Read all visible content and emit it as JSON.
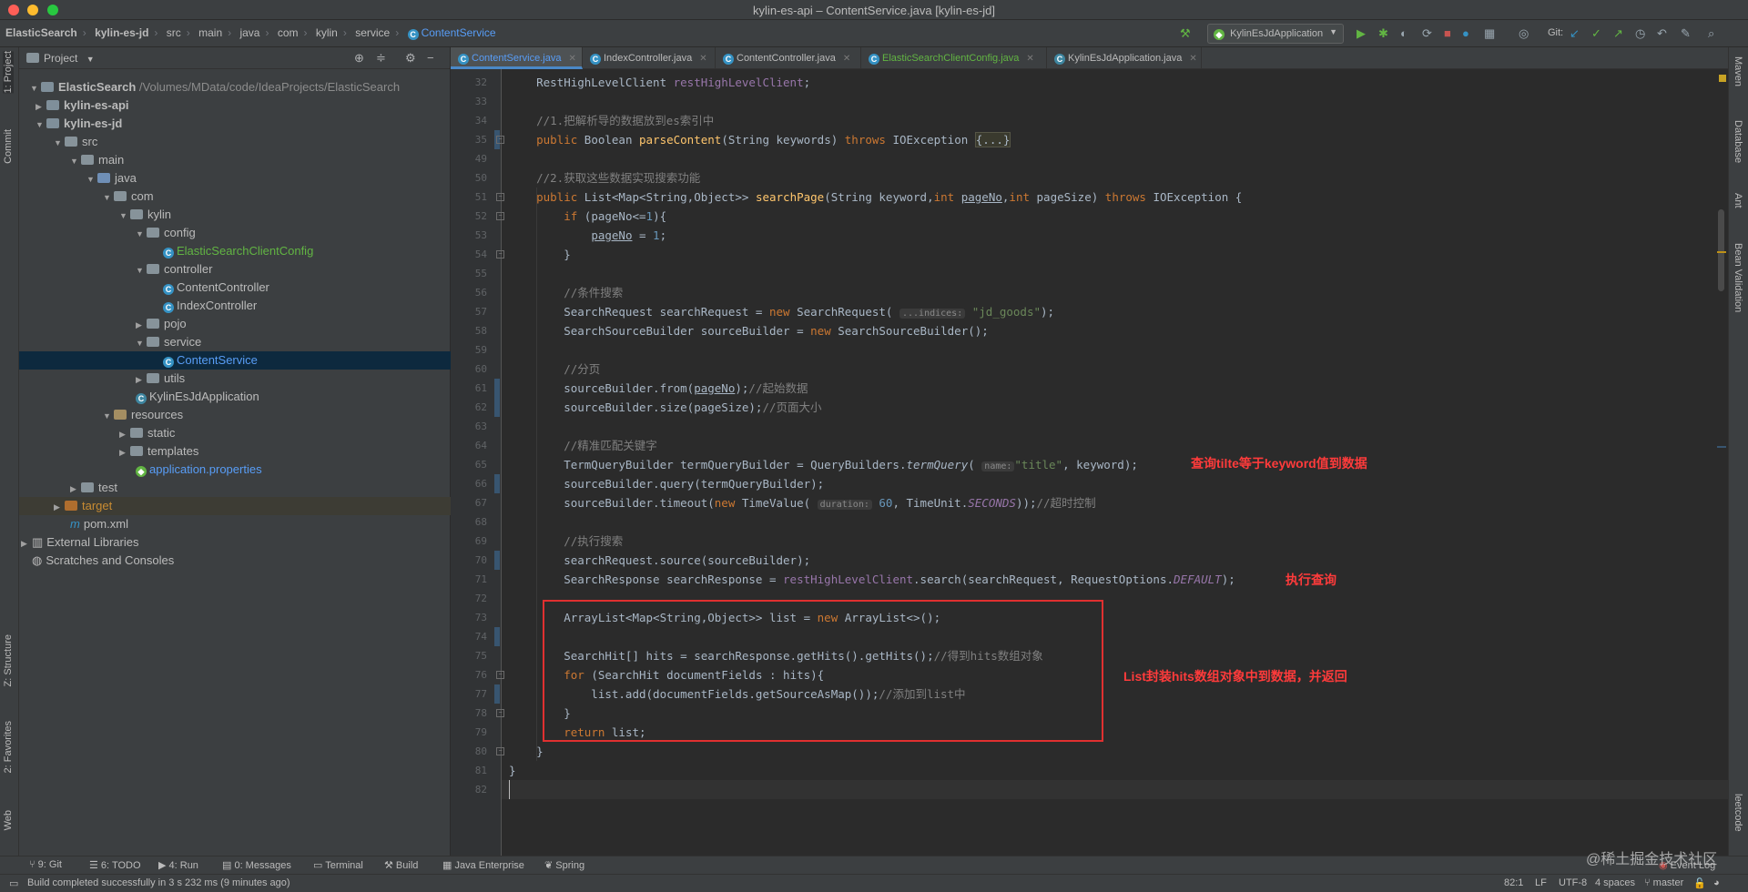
{
  "window": {
    "title": "kylin-es-api – ContentService.java [kylin-es-jd]"
  },
  "breadcrumbs": [
    "ElasticSearch",
    "kylin-es-jd",
    "src",
    "main",
    "java",
    "com",
    "kylin",
    "service",
    "ContentService"
  ],
  "toolbar": {
    "run_config": "KylinEsJdApplication",
    "git_label": "Git:"
  },
  "left_strip": [
    "1: Project",
    "Commit",
    "Z: Structure",
    "2: Favorites",
    "Web"
  ],
  "right_strip": [
    "Maven",
    "Database",
    "Ant",
    "Bean Validation",
    "leetcode"
  ],
  "project": {
    "title": "Project",
    "root_name": "ElasticSearch",
    "root_path": "/Volumes/MData/code/IdeaProjects/ElasticSearch",
    "items": [
      "kylin-es-api",
      "kylin-es-jd",
      "src",
      "main",
      "java",
      "com",
      "kylin",
      "config",
      "ElasticSearchClientConfig",
      "controller",
      "ContentController",
      "IndexController",
      "pojo",
      "service",
      "ContentService",
      "utils",
      "KylinEsJdApplication",
      "resources",
      "static",
      "templates",
      "application.properties",
      "test",
      "target",
      "pom.xml",
      "External Libraries",
      "Scratches and Consoles"
    ]
  },
  "tabs": [
    "ContentService.java",
    "IndexController.java",
    "ContentController.java",
    "ElasticSearchClientConfig.java",
    "KylinEsJdApplication.java"
  ],
  "editor": {
    "line_numbers": [
      "32",
      "33",
      "34",
      "35",
      "49",
      "50",
      "51",
      "52",
      "53",
      "54",
      "55",
      "56",
      "57",
      "58",
      "59",
      "60",
      "61",
      "62",
      "63",
      "64",
      "65",
      "66",
      "67",
      "68",
      "69",
      "70",
      "71",
      "72",
      "73",
      "74",
      "75",
      "76",
      "77",
      "78",
      "79",
      "80",
      "81",
      "82"
    ],
    "hints": {
      "indices": "...indices:",
      "name": "name:",
      "duration": "duration:"
    },
    "fold_text": "{...}",
    "strings": {
      "jd_goods": "\"jd_goods\"",
      "title": "\"title\""
    },
    "comments": {
      "c34": "//1.把解析导的数据放到es索引中",
      "c50": "//2.获取这些数据实现搜索功能",
      "c56": "//条件搜索",
      "c60": "//分页",
      "c61": "//起始数据",
      "c62": "//页面大小",
      "c64": "//精准匹配关键字",
      "c67": "//超时控制",
      "c69": "//执行搜索",
      "c75": "//得到hits数组对象",
      "c77": "//添加到list中"
    }
  },
  "annotations": {
    "a1": "查询tilte等于keyword值到数据",
    "a2": "执行查询",
    "a3": "List封装hits数组对象中到数据，并返回"
  },
  "bottom_tools": [
    "9: Git",
    "6: TODO",
    "4: Run",
    "0: Messages",
    "Terminal",
    "Build",
    "Java Enterprise",
    "Spring"
  ],
  "event_log": "Event Log",
  "status": {
    "message": "Build completed successfully in 3 s 232 ms (9 minutes ago)",
    "position": "82:1",
    "line_sep": "LF",
    "encoding": "UTF-8",
    "indent": "4 spaces",
    "branch": "master"
  },
  "watermark": "@稀土掘金技术社区",
  "colors": {
    "accent": "#4a88c7",
    "keyword": "#cc7832",
    "string": "#6a8759",
    "annotation": "#ff3b3b"
  }
}
